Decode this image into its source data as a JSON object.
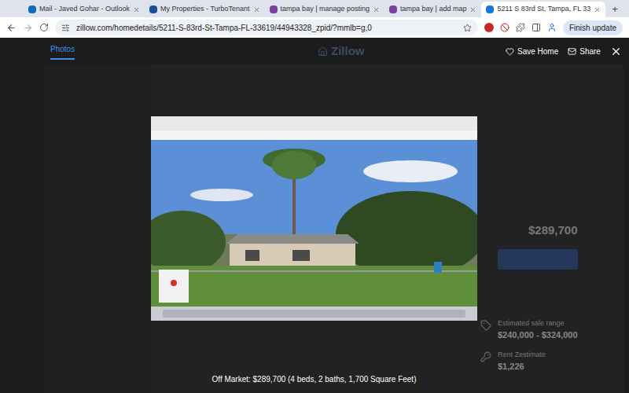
{
  "browser": {
    "tabs": [
      {
        "label": "Mail - Javed Gohar - Outlook",
        "selected": false,
        "color": "#0f6cbd"
      },
      {
        "label": "My Properties - TurboTenant",
        "selected": false,
        "color": "#1b4f9c"
      },
      {
        "label": "tampa bay | manage posting",
        "selected": false,
        "color": "#7b3fa0"
      },
      {
        "label": "tampa bay | add map",
        "selected": false,
        "color": "#7b3fa0"
      },
      {
        "label": "5211 S 83rd St, Tampa, FL 33",
        "selected": true,
        "color": "#1277e1"
      }
    ],
    "new_tab": "+",
    "url": "zillow.com/homedetails/5211-S-83rd-St-Tampa-FL-33619/44943328_zpid/?mmlb=g,0",
    "update_button": "Finish update"
  },
  "lightbox": {
    "tabs": [
      {
        "label": "Photos",
        "selected": true
      }
    ],
    "actions": [
      {
        "label": "Save Home"
      },
      {
        "label": "Share"
      }
    ],
    "caption": "Off Market: $289,700 (4 beds, 2 baths, 1,700 Square Feet)"
  },
  "page": {
    "logo": "Zillow",
    "price": "$289,700",
    "estimate_label": "Estimated sale range",
    "estimate": "$240,000 - $324,000",
    "rent_label": "Rent Zestimate",
    "rent": "$1,226"
  }
}
